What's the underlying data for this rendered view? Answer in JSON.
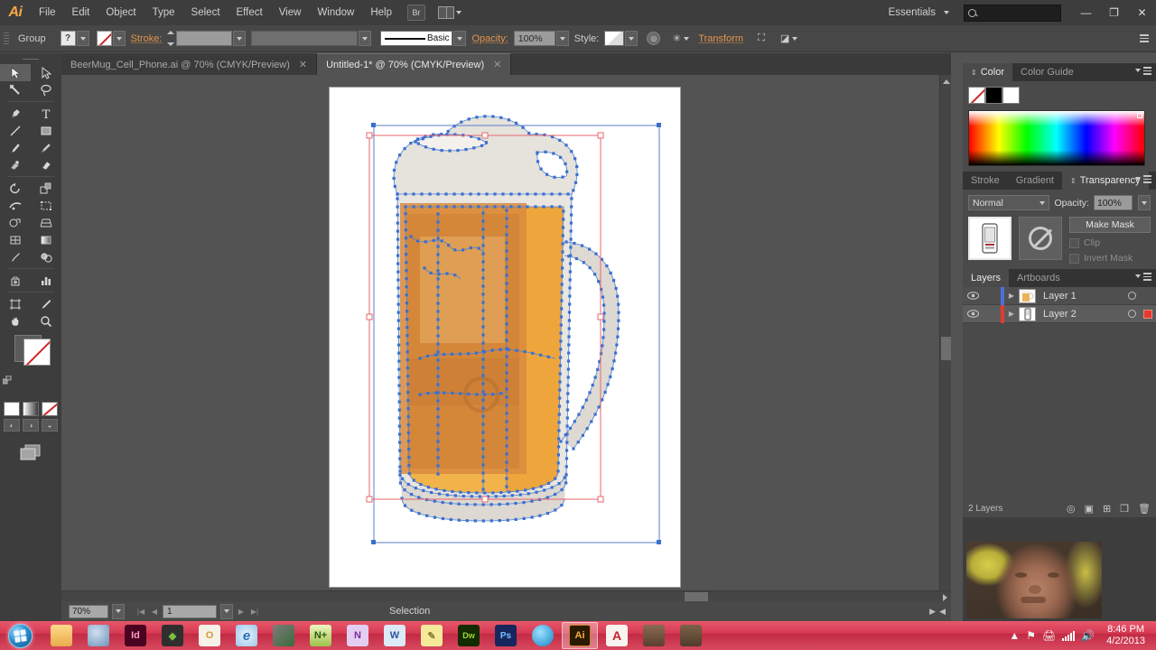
{
  "app": {
    "name": "Adobe Illustrator",
    "logo": "Ai"
  },
  "menubar": {
    "items": [
      {
        "label": "File"
      },
      {
        "label": "Edit"
      },
      {
        "label": "Object"
      },
      {
        "label": "Type"
      },
      {
        "label": "Select"
      },
      {
        "label": "Effect"
      },
      {
        "label": "View"
      },
      {
        "label": "Window"
      },
      {
        "label": "Help"
      }
    ],
    "bridge_label": "Br",
    "workspace": "Essentials",
    "search_placeholder": "",
    "window_buttons": {
      "minimize": "—",
      "restore": "❐",
      "close": "✕"
    }
  },
  "controlbar": {
    "selection_label": "Group",
    "fill_value": "?",
    "stroke_label": "Stroke:",
    "stroke_weight": "",
    "profile": "",
    "brush": "Basic",
    "opacity_label": "Opacity:",
    "opacity_value": "100%",
    "style_label": "Style:",
    "transform_label": "Transform"
  },
  "tabs": [
    {
      "title": "BeerMug_Cell_Phone.ai @ 70% (CMYK/Preview)",
      "close": "✕",
      "active": false
    },
    {
      "title": "Untitled-1* @ 70% (CMYK/Preview)",
      "close": "✕",
      "active": true
    }
  ],
  "toolbar": {
    "tools": [
      {
        "name": "selection-tool",
        "active": true
      },
      {
        "name": "direct-selection-tool",
        "active": false
      },
      {
        "name": "magic-wand-tool",
        "active": false
      },
      {
        "name": "lasso-tool",
        "active": false
      },
      {
        "name": "pen-tool",
        "active": false
      },
      {
        "name": "type-tool",
        "active": false
      },
      {
        "name": "line-segment-tool",
        "active": false
      },
      {
        "name": "rectangle-tool",
        "active": false
      },
      {
        "name": "paintbrush-tool",
        "active": false
      },
      {
        "name": "pencil-tool",
        "active": false
      },
      {
        "name": "blob-brush-tool",
        "active": false
      },
      {
        "name": "eraser-tool",
        "active": false
      },
      {
        "name": "rotate-tool",
        "active": false
      },
      {
        "name": "scale-tool",
        "active": false
      },
      {
        "name": "width-tool",
        "active": false
      },
      {
        "name": "free-transform-tool",
        "active": false
      },
      {
        "name": "shape-builder-tool",
        "active": false
      },
      {
        "name": "perspective-grid-tool",
        "active": false
      },
      {
        "name": "mesh-tool",
        "active": false
      },
      {
        "name": "gradient-tool",
        "active": false
      },
      {
        "name": "eyedropper-tool",
        "active": false
      },
      {
        "name": "blend-tool",
        "active": false
      },
      {
        "name": "symbol-sprayer-tool",
        "active": false
      },
      {
        "name": "column-graph-tool",
        "active": false
      },
      {
        "name": "artboard-tool",
        "active": false
      },
      {
        "name": "slice-tool",
        "active": false
      },
      {
        "name": "hand-tool",
        "active": false
      },
      {
        "name": "zoom-tool",
        "active": false
      }
    ],
    "fill_value": "?",
    "stroke_value": "none"
  },
  "canvas": {
    "artwork_name": "beer-mug-with-cell-phone-vector-art",
    "selection_mode": "anchor-points-visible",
    "bounding_box_color": "#e8666b",
    "path_color": "#3a6fd8"
  },
  "statusbar": {
    "zoom": "70%",
    "page": "1",
    "status_text": "Selection"
  },
  "panels": {
    "color": {
      "tabs": [
        {
          "label": "Color",
          "active": true
        },
        {
          "label": "Color Guide",
          "active": false
        }
      ],
      "swatches": [
        "none",
        "#000000",
        "#ffffff"
      ]
    },
    "transparency": {
      "tabs": [
        {
          "label": "Stroke",
          "active": false
        },
        {
          "label": "Gradient",
          "active": false
        },
        {
          "label": "Transparency",
          "active": true
        }
      ],
      "blend_mode": "Normal",
      "opacity_label": "Opacity:",
      "opacity_value": "100%",
      "make_mask_label": "Make Mask",
      "clip_label": "Clip",
      "invert_mask_label": "Invert Mask",
      "clip_checked": false,
      "invert_checked": false
    },
    "layers": {
      "tabs": [
        {
          "label": "Layers",
          "active": true
        },
        {
          "label": "Artboards",
          "active": false
        }
      ],
      "rows": [
        {
          "name": "Layer 1",
          "color": "#4a6fe0",
          "selected": false,
          "has_selection_square": false,
          "thumb": "beer-mug-thumbnail"
        },
        {
          "name": "Layer 2",
          "color": "#e33a2e",
          "selected": true,
          "has_selection_square": true,
          "thumb": "cell-phone-thumbnail"
        }
      ],
      "footer_count": "2 Layers"
    }
  },
  "taskbar": {
    "apps": [
      {
        "name": "windows-explorer",
        "label": "",
        "color": "#f0c274"
      },
      {
        "name": "photo-viewer",
        "label": "",
        "color": "#7c9fc4"
      },
      {
        "name": "adobe-indesign",
        "label": "Id",
        "color": "#49021f"
      },
      {
        "name": "evernote",
        "label": "",
        "color": "#3a3a3a"
      },
      {
        "name": "microsoft-outlook",
        "label": "O",
        "color": "#f3efe6"
      },
      {
        "name": "internet-explorer",
        "label": "e",
        "color": "#d9e8f5"
      },
      {
        "name": "steam",
        "label": "",
        "color": "#4c4c4c"
      },
      {
        "name": "notepad-plus-plus",
        "label": "",
        "color": "#d8e86a"
      },
      {
        "name": "microsoft-onenote",
        "label": "N",
        "color": "#d6b3e8"
      },
      {
        "name": "microsoft-word",
        "label": "W",
        "color": "#c6dcf2"
      },
      {
        "name": "sticky-notes",
        "label": "",
        "color": "#f2e58a"
      },
      {
        "name": "adobe-dreamweaver",
        "label": "Dw",
        "color": "#1a3a00"
      },
      {
        "name": "adobe-photoshop",
        "label": "Ps",
        "color": "#1a2a5e"
      },
      {
        "name": "skype",
        "label": "",
        "color": "#1aa7e0"
      },
      {
        "name": "adobe-illustrator",
        "label": "Ai",
        "color": "#2b1a00"
      },
      {
        "name": "adobe-acrobat-reader",
        "label": "",
        "color": "#f5f0ea"
      },
      {
        "name": "media-app-1",
        "label": "",
        "color": "#6b4a3a"
      },
      {
        "name": "media-app-2",
        "label": "",
        "color": "#5a4437"
      }
    ],
    "time": "8:46 PM",
    "date": "4/2/2013"
  }
}
